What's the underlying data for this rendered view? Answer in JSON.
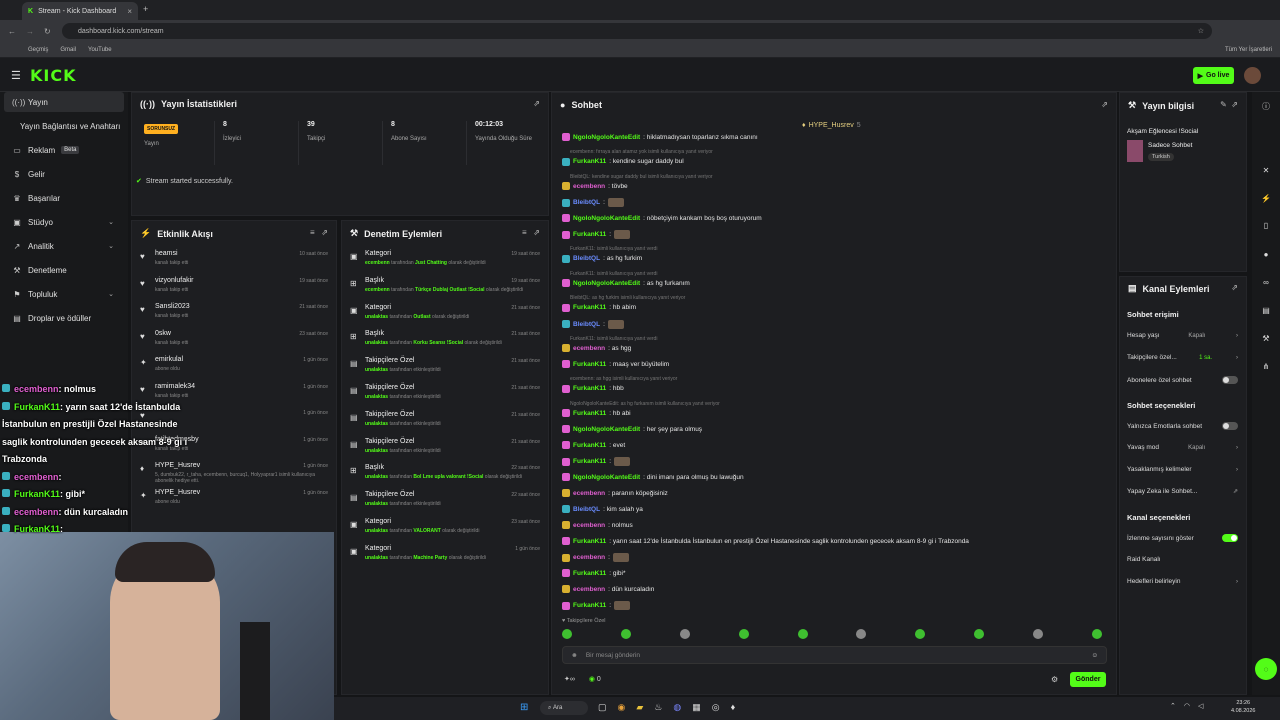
{
  "browser": {
    "tab_title": "Stream - Kick Dashboard",
    "url": "dashboard.kick.com/stream",
    "bookmarks": [
      "Geçmiş",
      "Gmail",
      "YouTube"
    ],
    "bookmarks_right": "Tüm Yer İşaretleri"
  },
  "topnav": {
    "logo": "KICK",
    "go_live": "Go live"
  },
  "sidebar": {
    "items": [
      {
        "label": "Yayın",
        "icon": "((·))"
      },
      {
        "label": "Yayın Bağlantısı ve Anahtarı",
        "icon": ""
      },
      {
        "label": "Reklam",
        "icon": "▭",
        "badge": "Beta"
      },
      {
        "label": "Gelir",
        "icon": "$"
      },
      {
        "label": "Başarılar",
        "icon": "♛"
      },
      {
        "label": "Stüdyo",
        "icon": "▣"
      },
      {
        "label": "Analitik",
        "icon": "↗"
      },
      {
        "label": "Denetleme",
        "icon": "⚒"
      },
      {
        "label": "Topluluk",
        "icon": "⚑"
      },
      {
        "label": "Droplar ve ödüller",
        "icon": "▤"
      }
    ]
  },
  "stats": {
    "title": "Yayın İstatistikleri",
    "status_badge": "SORUNSUZ",
    "status_label": "Yayın",
    "viewers": "8",
    "viewers_label": "İzleyici",
    "followers": "39",
    "followers_label": "Takipçi",
    "subs": "8",
    "subs_label": "Abone Sayısı",
    "duration": "00:12:03",
    "duration_label": "Yayında Olduğu Süre",
    "success": "Stream started successfully."
  },
  "activity": {
    "title": "Etkinlik Akışı",
    "rows": [
      {
        "name": "heamsi",
        "sub": "kanalı takip etti",
        "time": "10 saat önce"
      },
      {
        "name": "vizyonlufakir",
        "sub": "kanalı takip etti",
        "time": "19 saat önce"
      },
      {
        "name": "Sansli2023",
        "sub": "kanalı takip etti",
        "time": "21 saat önce"
      },
      {
        "name": "0skw",
        "sub": "kanalı takip etti",
        "time": "23 saat önce"
      },
      {
        "name": "emirkulal",
        "sub": "abone oldu",
        "time": "1 gün önce"
      },
      {
        "name": "ramimalek34",
        "sub": "kanalı takip etti",
        "time": "1 gün önce"
      },
      {
        "name": "",
        "sub": "",
        "time": "1 gün önce"
      },
      {
        "name": "fatihtedmosby",
        "sub": "kanalı takip etti",
        "time": "1 gün önce"
      },
      {
        "name": "HYPE_Husrev",
        "sub": "5, dumbuk22, r_taha, ecembenn, burcuq1, Holyyaprar1 isimli kullanıcıya abonelik hediye etti.",
        "time": "1 gün önce"
      },
      {
        "name": "HYPE_Husrev",
        "sub": "abone oldu",
        "time": "1 gün önce"
      }
    ]
  },
  "moderation": {
    "title": "Denetim Eylemleri",
    "rows": [
      {
        "name": "Kategori",
        "user": "ecembenn",
        "mid": "tarafından",
        "value": "Just Chatting",
        "end": "olarak değiştirildi",
        "time": "19 saat önce"
      },
      {
        "name": "Başlık",
        "user": "ecembenn",
        "mid": "tarafından",
        "value": "Türkçe Dublaj Outlast !Social",
        "end": "olarak değiştirildi",
        "time": "19 saat önce"
      },
      {
        "name": "Kategori",
        "user": "unalaktas",
        "mid": "tarafından",
        "value": "Outlast",
        "end": "olarak değiştirildi",
        "time": "21 saat önce"
      },
      {
        "name": "Başlık",
        "user": "unalaktas",
        "mid": "tarafından",
        "value": "Korku Seansı !Social",
        "end": "olarak değiştirildi",
        "time": "21 saat önce"
      },
      {
        "name": "Takipçilere Özel",
        "user": "unalaktas",
        "mid": "tarafından etkinleştirildi",
        "value": "",
        "end": "",
        "time": "21 saat önce"
      },
      {
        "name": "Takipçilere Özel",
        "user": "unalaktas",
        "mid": "tarafından etkinleştirildi",
        "value": "",
        "end": "",
        "time": "21 saat önce"
      },
      {
        "name": "Takipçilere Özel",
        "user": "unalaktas",
        "mid": "tarafından etkinleştirildi",
        "value": "",
        "end": "",
        "time": "21 saat önce"
      },
      {
        "name": "Takipçilere Özel",
        "user": "unalaktas",
        "mid": "tarafından etkinleştirildi",
        "value": "",
        "end": "",
        "time": "21 saat önce"
      },
      {
        "name": "Başlık",
        "user": "unalaktas",
        "mid": "tarafından",
        "value": "Bol Lme upla valorant !Social",
        "end": "olarak değiştirildi",
        "time": "22 saat önce"
      },
      {
        "name": "Takipçilere Özel",
        "user": "unalaktas",
        "mid": "tarafından etkinleştirildi",
        "value": "",
        "end": "",
        "time": "22 saat önce"
      },
      {
        "name": "Kategori",
        "user": "unalaktas",
        "mid": "tarafından",
        "value": "VALORANT",
        "end": "olarak değiştirildi",
        "time": "23 saat önce"
      },
      {
        "name": "Kategori",
        "user": "unalaktas",
        "mid": "tarafından",
        "value": "Machine Party",
        "end": "olarak değiştirildi",
        "time": "1 gün önce"
      }
    ]
  },
  "chat": {
    "title": "Sohbet",
    "pinned": "HYPE_Husrev",
    "pinned_count": "5",
    "messages": [
      {
        "user": "NgoloNgoloKanteEdit",
        "text": ": hiklatmadıysan toparlarız sıkma canını",
        "color": "#53fc18",
        "icon": "#e05fd0"
      },
      {
        "reply": "ecembenn: fırraya alan atamız yok isimli kullanıcıya yanıt veriyor"
      },
      {
        "user": "FurkanK11",
        "text": ": kendine sugar daddy bul",
        "color": "#53fc18",
        "icon": "#3ab0c0"
      },
      {
        "reply": "BleibtQL: kendine sugar daddy bul isimli kullanıcıya yanıt veriyor"
      },
      {
        "user": "ecembenn",
        "text": ": tövbe",
        "color": "#e05fd0",
        "icon": "#d8b030"
      },
      {
        "user": "BleibtQL",
        "text": ":",
        "color": "#6a8cff",
        "icon": "#3ab0c0",
        "emote": true
      },
      {
        "user": "NgoloNgoloKanteEdit",
        "text": ": nöbetçiyim kankam boş boş oturuyorum",
        "color": "#53fc18",
        "icon": "#e05fd0"
      },
      {
        "user": "FurkanK11",
        "text": ":",
        "color": "#53fc18",
        "icon": "#e05fd0",
        "emote": true
      },
      {
        "reply": "FurkanK11: isimli kullanıcıya yanıt verdi"
      },
      {
        "user": "BleibtQL",
        "text": ": as hg furkim",
        "color": "#6a8cff",
        "icon": "#3ab0c0"
      },
      {
        "reply": "FurkanK11: isimli kullanıcıya yanıt verdi"
      },
      {
        "user": "NgoloNgoloKanteEdit",
        "text": ": as hg furkanım",
        "color": "#53fc18",
        "icon": "#e05fd0"
      },
      {
        "reply": "BleibtQL: as hg furkim isimli kullanıcıya yanıt veriyor"
      },
      {
        "user": "FurkanK11",
        "text": ": hb abim",
        "color": "#53fc18",
        "icon": "#e05fd0"
      },
      {
        "user": "BleibtQL",
        "text": ":",
        "color": "#6a8cff",
        "icon": "#3ab0c0",
        "emote": true
      },
      {
        "reply": "FurkanK11: isimli kullanıcıya yanıt verdi"
      },
      {
        "user": "ecembenn",
        "text": ": as hgg",
        "color": "#e05fd0",
        "icon": "#d8b030"
      },
      {
        "user": "FurkanK11",
        "text": ": maaş ver büyütelim",
        "color": "#53fc18",
        "icon": "#e05fd0"
      },
      {
        "reply": "ecembenn: as hgg isimli kullanıcıya yanıt veriyor"
      },
      {
        "user": "FurkanK11",
        "text": ": hbb",
        "color": "#53fc18",
        "icon": "#e05fd0"
      },
      {
        "reply": "NgoloNgoloKanteEdit: as hg furkanım isimli kullanıcıya yanıt veriyor"
      },
      {
        "user": "FurkanK11",
        "text": ": hb abi",
        "color": "#53fc18",
        "icon": "#e05fd0"
      },
      {
        "user": "NgoloNgoloKanteEdit",
        "text": ": her şey para olmuş",
        "color": "#53fc18",
        "icon": "#e05fd0"
      },
      {
        "user": "FurkanK11",
        "text": ": evet",
        "color": "#53fc18",
        "icon": "#e05fd0"
      },
      {
        "user": "FurkanK11",
        "text": ":",
        "color": "#53fc18",
        "icon": "#e05fd0",
        "emote": true
      },
      {
        "user": "NgoloNgoloKanteEdit",
        "text": ": dini imanı para olmuş bu lawuğun",
        "color": "#53fc18",
        "icon": "#e05fd0"
      },
      {
        "user": "ecembenn",
        "text": ": paranın köpeğisiniz",
        "color": "#e05fd0",
        "icon": "#d8b030"
      },
      {
        "user": "BleibtQL",
        "text": ": kim salah ya",
        "color": "#6a8cff",
        "icon": "#3ab0c0"
      },
      {
        "user": "ecembenn",
        "text": ": nolmus",
        "color": "#e05fd0",
        "icon": "#d8b030"
      },
      {
        "user": "FurkanK11",
        "text": ": yarın saat 12'de İstanbulda İstanbulun en prestijli Özel Hastanesinde saglik kontrolunden gececek aksam 8-9 gi i Trabzonda",
        "color": "#53fc18",
        "icon": "#e05fd0"
      },
      {
        "user": "ecembenn",
        "text": ":",
        "color": "#e05fd0",
        "icon": "#d8b030",
        "emote": true
      },
      {
        "user": "FurkanK11",
        "text": ": gibi*",
        "color": "#53fc18",
        "icon": "#e05fd0"
      },
      {
        "user": "ecembenn",
        "text": ": dün kurcaladın",
        "color": "#e05fd0",
        "icon": "#d8b030"
      },
      {
        "user": "FurkanK11",
        "text": ":",
        "color": "#53fc18",
        "icon": "#e05fd0",
        "emote": true
      }
    ],
    "followers_only": "Takipçilere Özel",
    "input_placeholder": "Bir mesaj gönderin",
    "points": "0",
    "send": "Gönder"
  },
  "stream_info": {
    "title": "Yayın bilgisi",
    "stream_title": "Akşam Eğlencesi !Social",
    "category": "Sadece Sohbet",
    "tag": "Turkish"
  },
  "channel_actions": {
    "title": "Kanal Eylemleri",
    "chat_access": "Sohbet erişimi",
    "account_age": "Hesap yaşı",
    "account_age_val": "Kapalı",
    "followers_only": "Takipçilere özel...",
    "followers_only_val": "1 sa.",
    "subs_only": "Abonelere özel sohbet",
    "chat_options": "Sohbet seçenekleri",
    "emotes_only": "Yalnızca Emotlarla sohbet",
    "slow_mode": "Yavaş mod",
    "slow_mode_val": "Kapalı",
    "banned_words": "Yasaklanmış kelimeler",
    "ai_chat": "Yapay Zeka ile Sohbet...",
    "channel_options": "Kanal seçenekleri",
    "show_viewers": "İzlenme sayısını göster",
    "raid": "Raid Kanalı",
    "goals": "Hedefleri belirleyin"
  },
  "overlay": [
    {
      "user": "ecembenn",
      "text": ": nolmus",
      "color": "#e05fd0"
    },
    {
      "user": "FurkanK11",
      "text": ": yarın saat 12'de İstanbulda",
      "color": "#53fc18"
    },
    {
      "user": "",
      "text": "İstanbulun en prestijli Özel Hastanesinde",
      "color": "#fff"
    },
    {
      "user": "",
      "text": "saglik kontrolunden gececek aksam 8-9 gi i",
      "color": "#fff"
    },
    {
      "user": "",
      "text": "Trabzonda",
      "color": "#fff"
    },
    {
      "user": "ecembenn",
      "text": ":",
      "color": "#e05fd0"
    },
    {
      "user": "FurkanK11",
      "text": ": gibi*",
      "color": "#53fc18"
    },
    {
      "user": "ecembenn",
      "text": ": dün kurcaladın",
      "color": "#e05fd0"
    },
    {
      "user": "FurkanK11",
      "text": ":",
      "color": "#53fc18"
    }
  ],
  "taskbar": {
    "search": "Ara",
    "time": "23:26",
    "date": "4.08.2026"
  }
}
